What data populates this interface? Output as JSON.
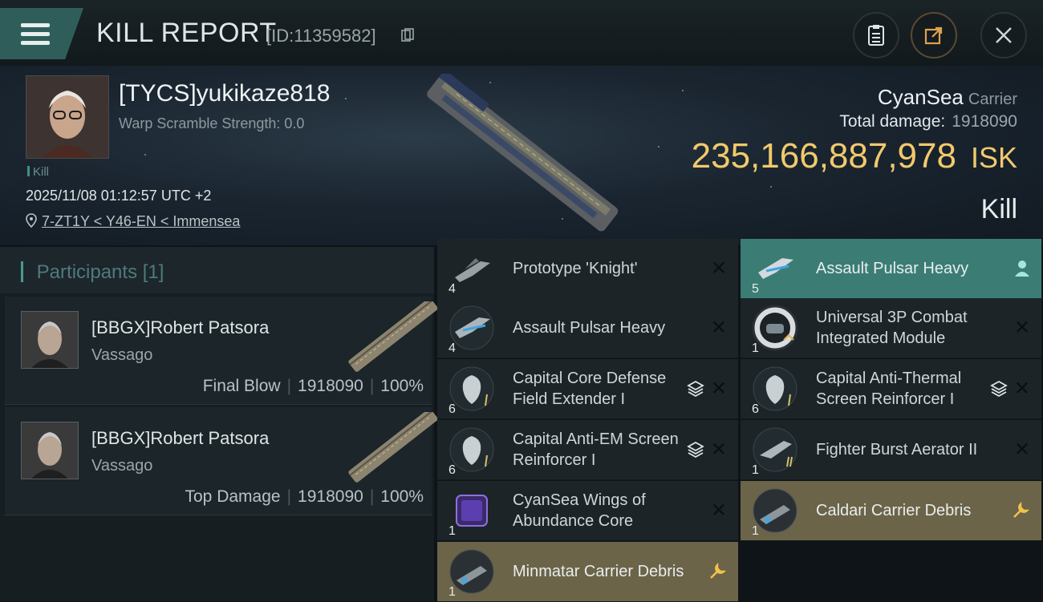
{
  "header": {
    "title": "KILL REPORT",
    "report_id": "[ID:11359582]",
    "buttons": [
      "clipboard-icon",
      "export-icon",
      "close-icon"
    ]
  },
  "victim": {
    "name": "[TYCS]yukikaze818",
    "warp_scramble": "Warp Scramble Strength: 0.0",
    "kill_tag": "Kill",
    "timestamp": "2025/11/08 01:12:57 UTC +2",
    "location": "7-ZT1Y < Y46-EN < Immensea",
    "ship": "CyanSea",
    "ship_class": "Carrier",
    "total_damage_label": "Total damage:",
    "total_damage": "1918090",
    "isk_value": "235,166,887,978",
    "isk_unit": "ISK",
    "result": "Kill"
  },
  "participants": {
    "title": "Participants",
    "count": "[1]",
    "rows": [
      {
        "name": "[BBGX]Robert Patsora",
        "ship": "Vassago",
        "role": "Final Blow",
        "damage": "1918090",
        "percent": "100%"
      },
      {
        "name": "[BBGX]Robert Patsora",
        "ship": "Vassago",
        "role": "Top Damage",
        "damage": "1918090",
        "percent": "100%"
      }
    ]
  },
  "items": {
    "left": [
      {
        "qty": "4",
        "name": "Prototype 'Knight'",
        "icon": "fighter-icon"
      },
      {
        "qty": "4",
        "name": "Assault Pulsar Heavy",
        "icon": "fighter-icon"
      },
      {
        "qty": "6",
        "name": "Capital Core Defense Field Extender I",
        "icon": "shield-module-icon"
      },
      {
        "qty": "6",
        "name": "Capital Anti-EM Screen Reinforcer I",
        "icon": "shield-module-icon"
      },
      {
        "qty": "1",
        "name": "CyanSea Wings of Abundance Core",
        "icon": "core-icon"
      },
      {
        "qty": "1",
        "name": "Minmatar Carrier Debris",
        "icon": "debris-icon"
      }
    ],
    "right": [
      {
        "qty": "5",
        "name": "Assault Pulsar Heavy",
        "icon": "fighter-icon"
      },
      {
        "qty": "1",
        "name": "Universal 3P Combat Integrated Module",
        "icon": "module-icon"
      },
      {
        "qty": "6",
        "name": "Capital Anti-Thermal Screen Reinforcer I",
        "icon": "shield-module-icon"
      },
      {
        "qty": "1",
        "name": "Fighter Burst Aerator II",
        "icon": "fighter-module-icon"
      },
      {
        "qty": "1",
        "name": "Caldari Carrier Debris",
        "icon": "debris-icon"
      }
    ]
  },
  "colors": {
    "accent": "#3b7d74",
    "isk": "#f1c96d",
    "dropped": "#6b6448"
  }
}
